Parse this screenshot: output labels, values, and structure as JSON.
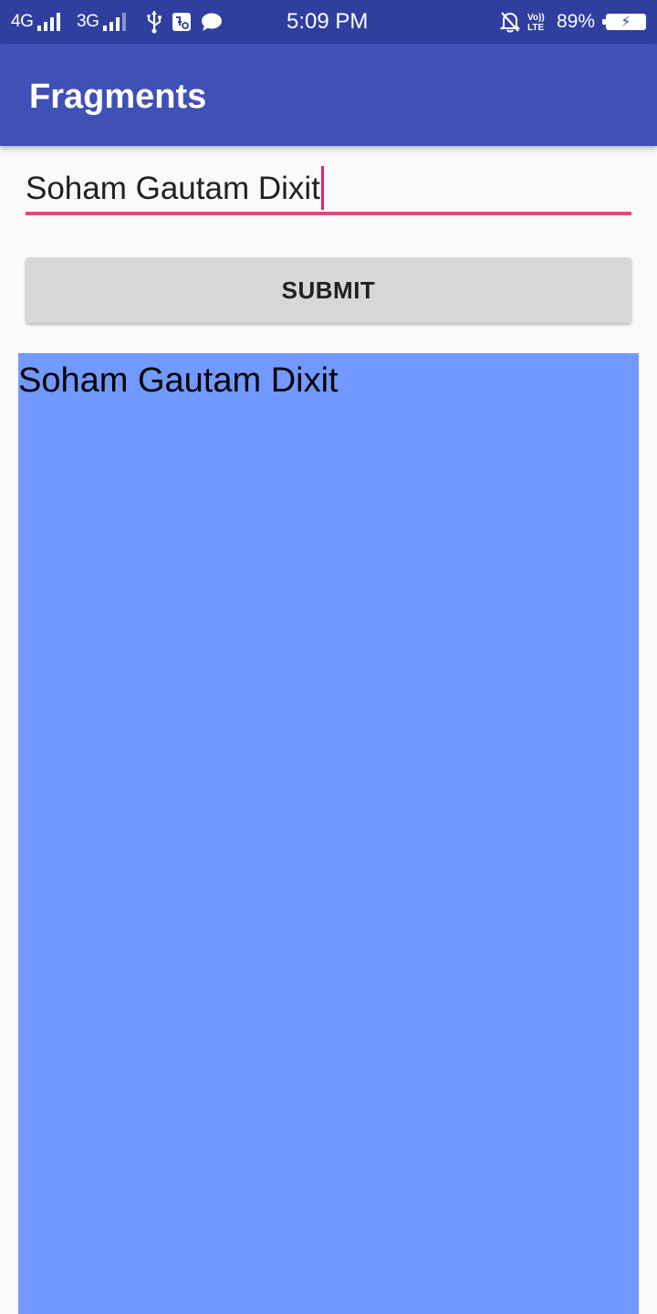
{
  "status_bar": {
    "network1": "4G",
    "network2": "3G",
    "time": "5:09 PM",
    "volte": "Vo)) LTE",
    "battery_percent": "89%",
    "icons": [
      "signal-icon",
      "signal-icon",
      "usb-icon",
      "app-notification-icon",
      "chat-icon",
      "silent-alarm-icon",
      "volte-icon",
      "battery-charging-icon"
    ],
    "background_color": "#303f9f"
  },
  "app_bar": {
    "title": "Fragments",
    "background_color": "#3f51b5"
  },
  "form": {
    "name_value": "Soham Gautam Dixit",
    "underline_color": "#e8457a",
    "submit_label": "SUBMIT"
  },
  "fragment": {
    "display_text": "Soham Gautam Dixit",
    "background_color": "#7299ff"
  }
}
